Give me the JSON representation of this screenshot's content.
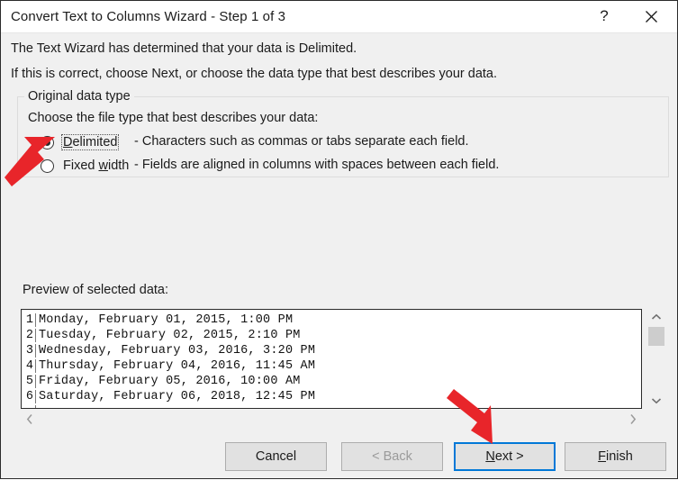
{
  "window": {
    "title": "Convert Text to Columns Wizard - Step 1 of 3",
    "help_icon": "question-mark-icon",
    "close_icon": "close-x-icon"
  },
  "description": {
    "line1": "The Text Wizard has determined that your data is Delimited.",
    "line2": "If this is correct, choose Next, or choose the data type that best describes your data."
  },
  "original_data_type": {
    "group_label": "Original data type",
    "choose_label": "Choose the file type that best describes your data:",
    "options": [
      {
        "label_prefix": "",
        "label_underlined": "D",
        "label_suffix": "elimited",
        "label_full": "Delimited",
        "description": "- Characters such as commas or tabs separate each field.",
        "selected": true,
        "focused": true
      },
      {
        "label_prefix": "Fixed ",
        "label_underlined": "w",
        "label_suffix": "idth",
        "label_full": "Fixed width",
        "description": "- Fields are aligned in columns with spaces between each field.",
        "selected": false,
        "focused": false
      }
    ]
  },
  "preview": {
    "label": "Preview of selected data:",
    "rows": [
      {
        "num": "1",
        "text": "Monday, February 01, 2015, 1:00 PM"
      },
      {
        "num": "2",
        "text": "Tuesday, February 02, 2015, 2:10 PM"
      },
      {
        "num": "3",
        "text": "Wednesday, February 03, 2016, 3:20 PM"
      },
      {
        "num": "4",
        "text": "Thursday, February 04, 2016, 11:45 AM"
      },
      {
        "num": "5",
        "text": "Friday, February 05, 2016, 10:00 AM"
      },
      {
        "num": "6",
        "text": "Saturday, February 06, 2018, 12:45 PM"
      }
    ],
    "scrollbars": {
      "v_up_icon": "chevron-up-icon",
      "v_down_icon": "chevron-down-icon",
      "h_left_icon": "chevron-left-icon",
      "h_right_icon": "chevron-right-icon"
    }
  },
  "footer": {
    "cancel": "Cancel",
    "back": "< Back",
    "back_enabled": false,
    "next_prefix": "",
    "next_underlined": "N",
    "next_suffix": "ext >",
    "next_full": "Next >",
    "next_focused": true,
    "finish_prefix": "",
    "finish_underlined": "F",
    "finish_suffix": "inish",
    "finish_full": "Finish"
  },
  "annotations": {
    "arrow_color": "#e8252a",
    "arrow_1_target": "delimited-radio-button",
    "arrow_2_target": "next-button"
  },
  "colors": {
    "dialog_background": "#f0f0f0",
    "titlebar_background": "#ffffff",
    "focus_blue": "#0078d7",
    "button_face": "#e1e1e1",
    "text": "#1b1b1b",
    "disabled_text": "#9a9a9a"
  }
}
